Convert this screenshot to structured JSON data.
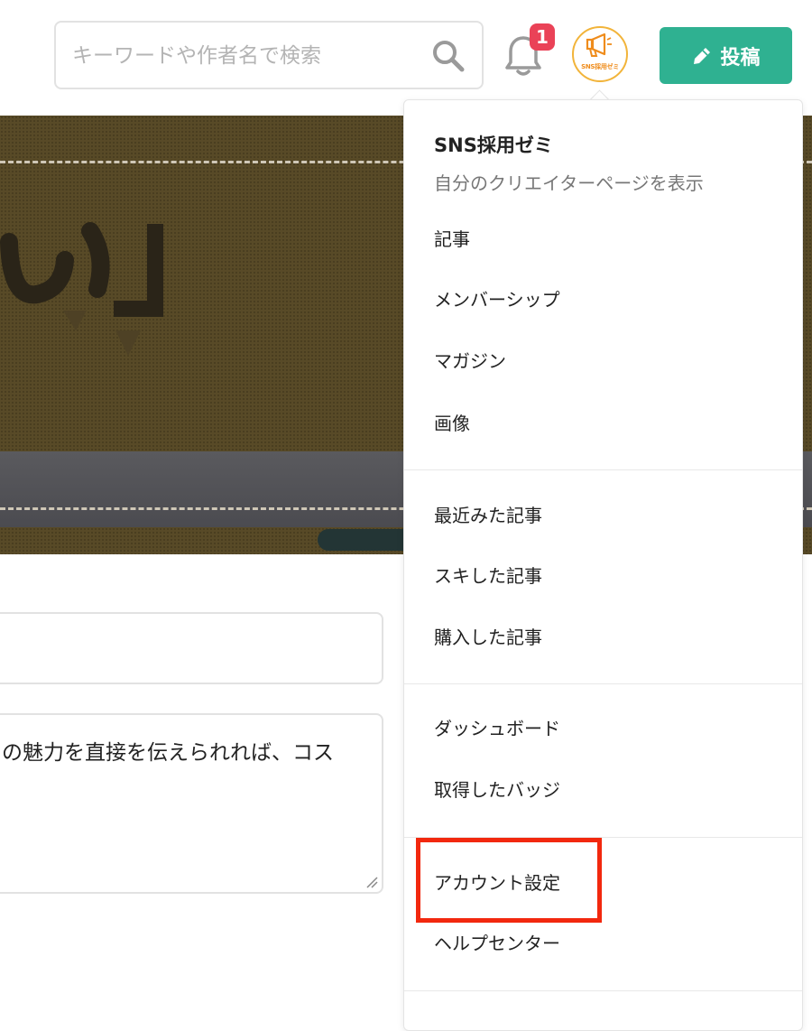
{
  "header": {
    "search": {
      "placeholder": "キーワードや作者名で検索",
      "value": ""
    },
    "notification": {
      "icon": "bell-icon",
      "count": "1"
    },
    "avatar": {
      "logo_text": "SNS採用ゼミ"
    },
    "post_button": {
      "label": "投稿",
      "icon": "pencil-icon"
    }
  },
  "banner": {
    "glyph": "い」"
  },
  "form": {
    "body_text": "の魅力を直接を伝えられれば、コス"
  },
  "dropdown": {
    "user": {
      "name": "SNS採用ゼミ",
      "subtitle": "自分のクリエイターページを表示"
    },
    "section1": [
      "記事",
      "メンバーシップ",
      "マガジン",
      "画像"
    ],
    "section2": [
      "最近みた記事",
      "スキした記事",
      "購入した記事"
    ],
    "section3": [
      "ダッシュボード",
      "取得したバッジ"
    ],
    "section4": [
      "アカウント設定",
      "ヘルプセンター"
    ]
  },
  "colors": {
    "accent": "#2fb191",
    "badge": "#ea4257",
    "highlight": "#f2280e",
    "banner": "#584a27"
  }
}
